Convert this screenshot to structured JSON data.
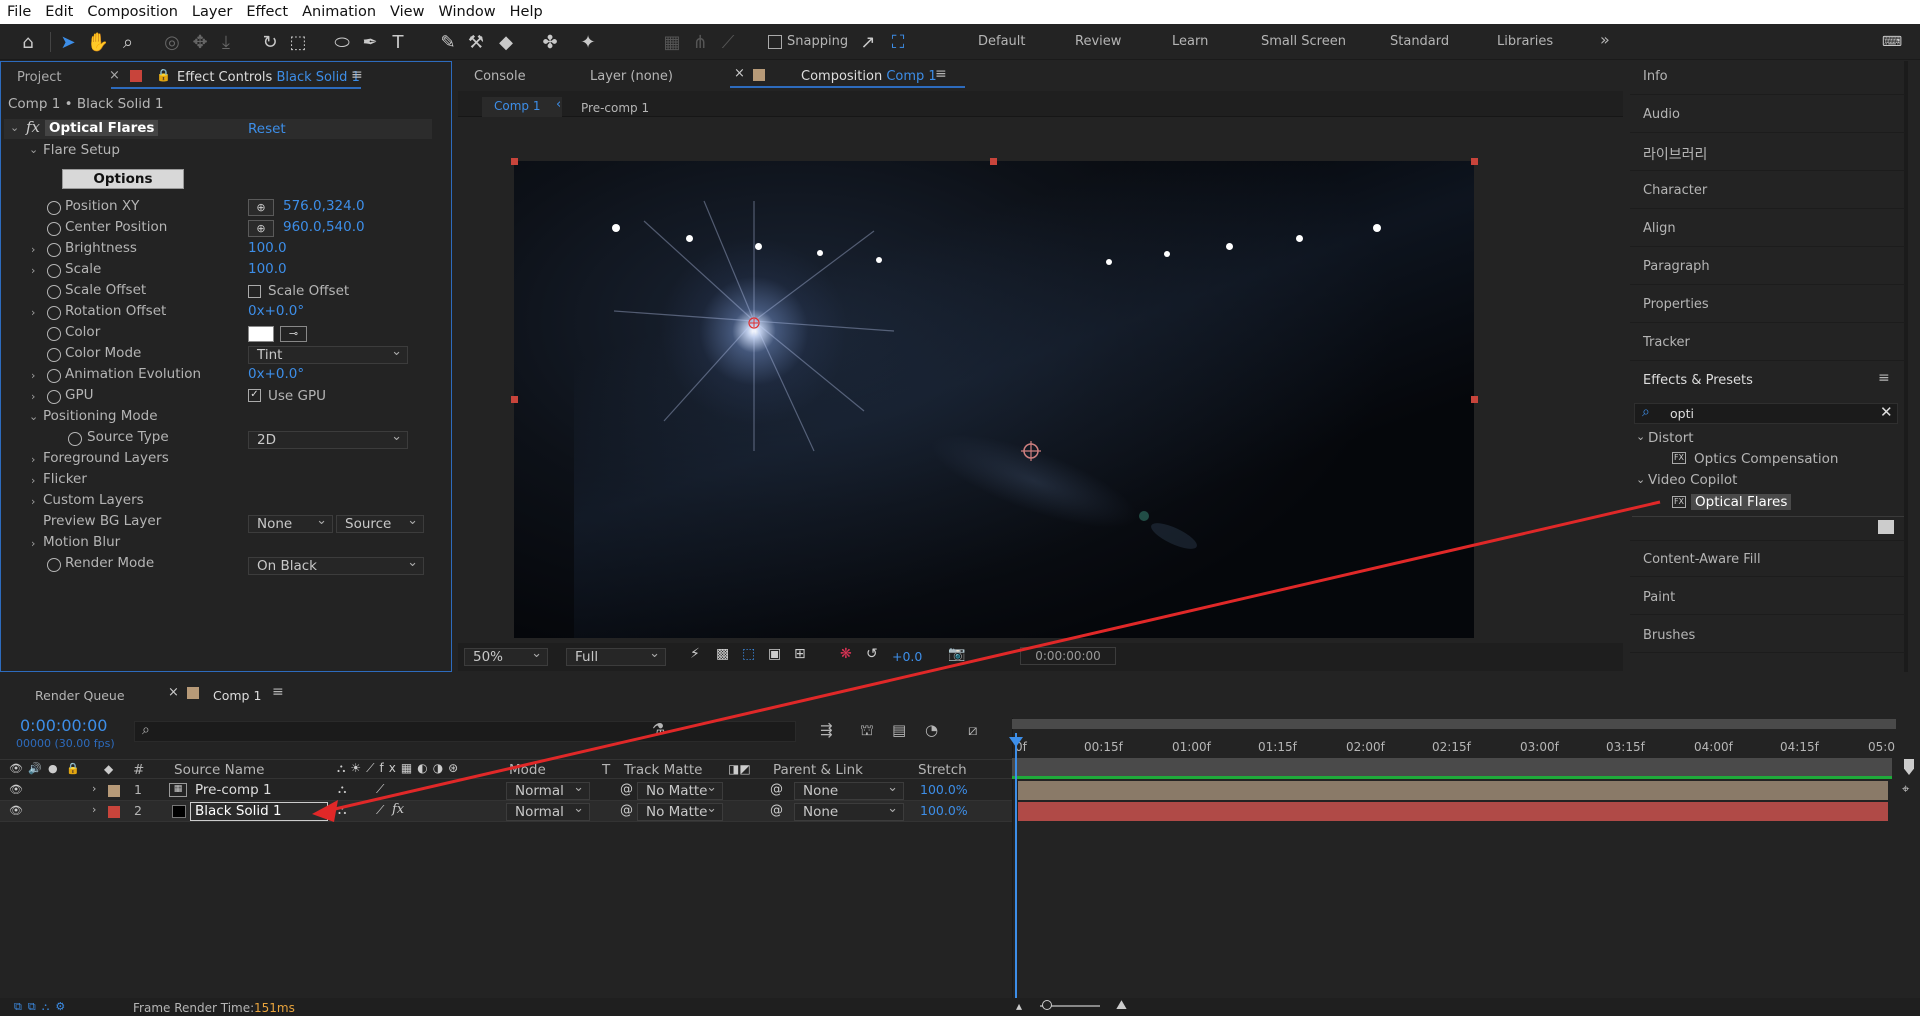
{
  "menu": [
    "File",
    "Edit",
    "Composition",
    "Layer",
    "Effect",
    "Animation",
    "View",
    "Window",
    "Help"
  ],
  "toolbar": {
    "snapping_label": "Snapping",
    "workspaces": [
      "Default",
      "Review",
      "Learn",
      "Small Screen",
      "Standard",
      "Libraries"
    ],
    "more": "»"
  },
  "left_panel": {
    "tab_project": "Project",
    "tab_effect_controls": "Effect Controls",
    "tab_effect_layer": "Black Solid 1",
    "breadcrumb": "Comp 1 • Black Solid 1",
    "effect_name": "Optical Flares",
    "reset_label": "Reset",
    "section_flare_setup": "Flare Setup",
    "options_button": "Options",
    "props": {
      "position_xy": {
        "label": "Position XY",
        "value": "576.0,324.0"
      },
      "center_position": {
        "label": "Center Position",
        "value": "960.0,540.0"
      },
      "brightness": {
        "label": "Brightness",
        "value": "100.0"
      },
      "scale": {
        "label": "Scale",
        "value": "100.0"
      },
      "scale_offset": {
        "label": "Scale Offset",
        "checkbox_label": "Scale Offset"
      },
      "rotation_offset": {
        "label": "Rotation Offset",
        "value": "0x+0.0°"
      },
      "color": {
        "label": "Color",
        "value_hex": "#ffffff"
      },
      "color_mode": {
        "label": "Color Mode",
        "value": "Tint"
      },
      "animation_evolution": {
        "label": "Animation Evolution",
        "value": "0x+0.0°"
      },
      "gpu": {
        "label": "GPU",
        "checkbox_label": "Use GPU",
        "checked": true
      },
      "positioning_mode": {
        "label": "Positioning Mode"
      },
      "source_type": {
        "label": "Source Type",
        "value": "2D"
      },
      "foreground_layers": {
        "label": "Foreground Layers"
      },
      "flicker": {
        "label": "Flicker"
      },
      "custom_layers": {
        "label": "Custom Layers"
      },
      "preview_bg_layer": {
        "label": "Preview BG Layer",
        "value1": "None",
        "value2": "Source"
      },
      "motion_blur": {
        "label": "Motion Blur"
      },
      "render_mode": {
        "label": "Render Mode",
        "value": "On Black"
      }
    }
  },
  "viewer": {
    "tab_console": "Console",
    "tab_layer": "Layer (none)",
    "tab_composition": "Composition",
    "tab_comp_name": "Comp 1",
    "nav_comp1": "Comp 1",
    "nav_precomp": "Pre-comp 1",
    "zoom": "50%",
    "resolution": "Full",
    "exposure": "+0.0",
    "timecode": "0:00:00:00"
  },
  "right_panel": {
    "items_top": [
      "Info",
      "Audio",
      "라이브러리",
      "Character",
      "Align",
      "Paragraph",
      "Properties",
      "Tracker"
    ],
    "effects_title": "Effects & Presets",
    "search_value": "opti",
    "tree": {
      "distort": "Distort",
      "optics_comp": "Optics Compensation",
      "video_copilot": "Video Copilot",
      "optical_flares": "Optical Flares"
    },
    "items_bottom": [
      "Content-Aware Fill",
      "Paint",
      "Brushes"
    ]
  },
  "timeline": {
    "tab_render_queue": "Render Queue",
    "tab_comp": "Comp 1",
    "timecode": "0:00:00:00",
    "frame_info": "00000 (30.00 fps)",
    "headers": {
      "num": "#",
      "source": "Source Name",
      "mode": "Mode",
      "t": "T",
      "track_matte": "Track Matte",
      "parent": "Parent & Link",
      "stretch": "Stretch"
    },
    "layers": [
      {
        "num": "1",
        "name": "Pre-comp 1",
        "mode": "Normal",
        "matte": "No Matte",
        "parent": "None",
        "stretch": "100.0%",
        "label_color": "#b79a78"
      },
      {
        "num": "2",
        "name": "Black Solid 1",
        "mode": "Normal",
        "matte": "No Matte",
        "parent": "None",
        "stretch": "100.0%",
        "label_color": "#c8443b"
      }
    ],
    "ruler": [
      "0f",
      "00:15f",
      "01:00f",
      "01:15f",
      "02:00f",
      "02:15f",
      "03:00f",
      "03:15f",
      "04:00f",
      "04:15f",
      "05:0"
    ],
    "footer_label": "Frame Render Time:",
    "footer_value": "151ms"
  }
}
